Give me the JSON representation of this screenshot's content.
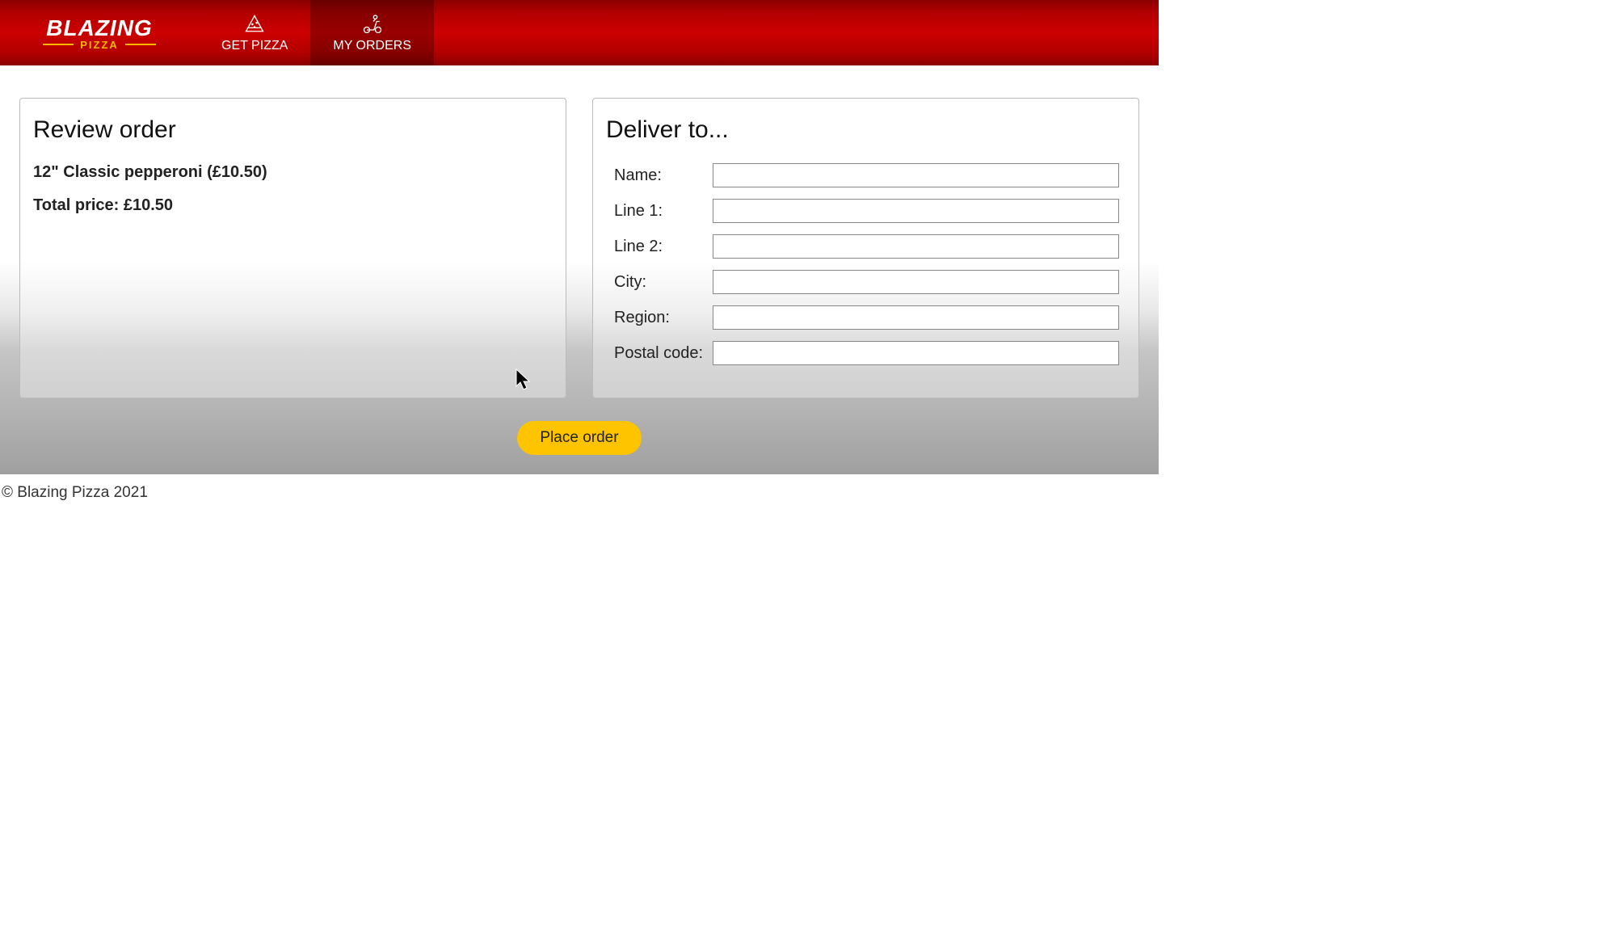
{
  "brand": {
    "main": "BLAZING",
    "sub": "PIZZA"
  },
  "nav": {
    "get_pizza": "GET PIZZA",
    "my_orders": "MY ORDERS"
  },
  "review": {
    "title": "Review order",
    "item_line": "12\" Classic pepperoni (£10.50)",
    "total_line": "Total price: £10.50"
  },
  "delivery": {
    "title": "Deliver to...",
    "fields": {
      "name": {
        "label": "Name:",
        "value": ""
      },
      "line1": {
        "label": "Line 1:",
        "value": ""
      },
      "line2": {
        "label": "Line 2:",
        "value": ""
      },
      "city": {
        "label": "City:",
        "value": ""
      },
      "region": {
        "label": "Region:",
        "value": ""
      },
      "postal": {
        "label": "Postal code:",
        "value": ""
      }
    }
  },
  "actions": {
    "place_order": "Place order"
  },
  "footer": {
    "copyright": "© Blazing Pizza 2021"
  }
}
